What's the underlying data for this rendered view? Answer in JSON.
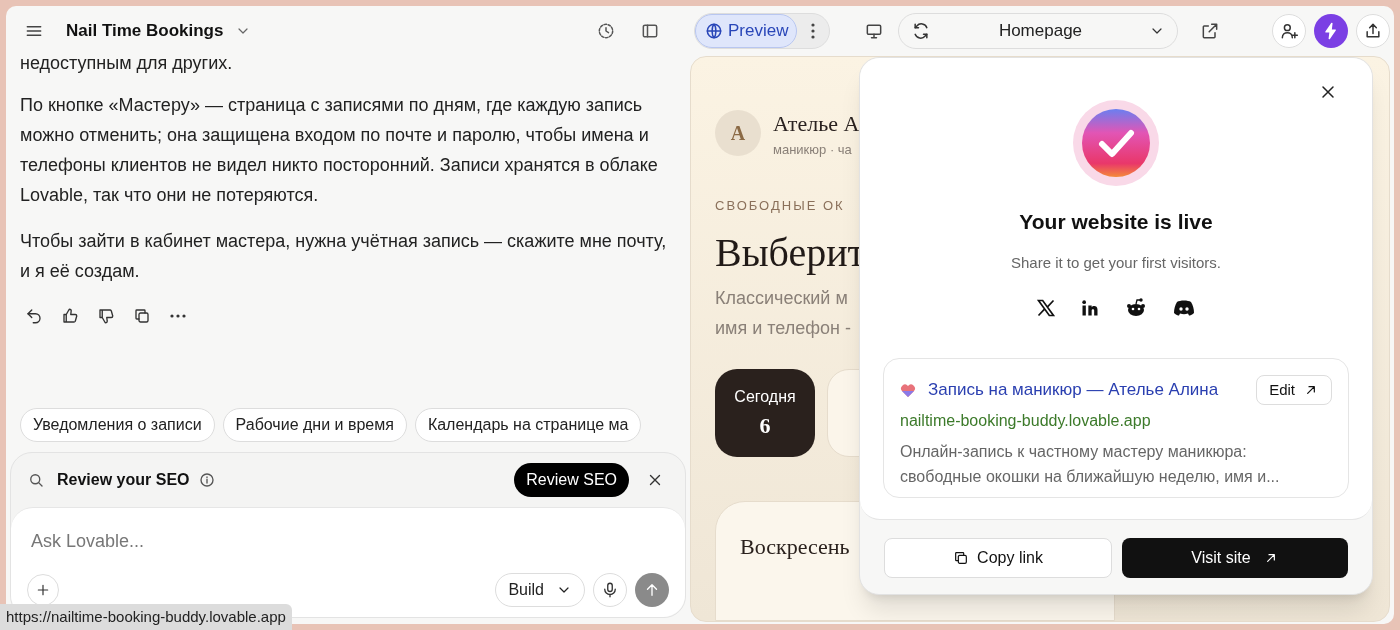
{
  "header": {
    "project": "Nail Time Bookings",
    "preview_tab": {
      "label": "Preview",
      "selected": true
    },
    "page_select": "Homepage"
  },
  "chat": {
    "paragraphs": [
      "недоступным для других.",
      "По кнопке «Мастеру» — страница с записями по дням, где каждую запись можно отменить; она защищена входом по почте и паролю, чтобы имена и телефоны клиентов не видел никто посторонний. Записи хранятся в облаке Lovable, так что они не потеряются.",
      "Чтобы зайти в кабинет мастера, нужна учётная запись — скажите мне почту, и я её создам."
    ],
    "suggestions": [
      "Уведомления о записи",
      "Рабочие дни и время",
      "Календарь на странице ма"
    ]
  },
  "seo_bar": {
    "label": "Review your SEO",
    "button": "Review SEO"
  },
  "composer": {
    "placeholder": "Ask Lovable...",
    "mode": "Build"
  },
  "status_url": "https://nailtime-booking-buddy.lovable.app",
  "site": {
    "avatar": "А",
    "name": "Ателье А",
    "subtitle": "маникюр · ча",
    "eyebrow": "СВОБОДНЫЕ ОК",
    "heading": "Выберит",
    "lead": [
      "Классический м",
      "имя и телефон -"
    ],
    "days": [
      {
        "label": "Сегодня",
        "date": "6",
        "selected": true
      },
      {
        "selected": false
      }
    ],
    "day_card_title": "Воскресень"
  },
  "popup": {
    "title": "Your website is live",
    "subtitle": "Share it to get your first visitors.",
    "seo_card": {
      "title": "Запись на маникюр — Ателье Алина",
      "edit": "Edit",
      "url": "nailtime-booking-buddy.lovable.app",
      "description": "Онлайн-запись к частному мастеру маникюра: свободные окошки на ближайшую неделю, имя и..."
    },
    "copy_button": "Copy link",
    "visit_button": "Visit site"
  }
}
